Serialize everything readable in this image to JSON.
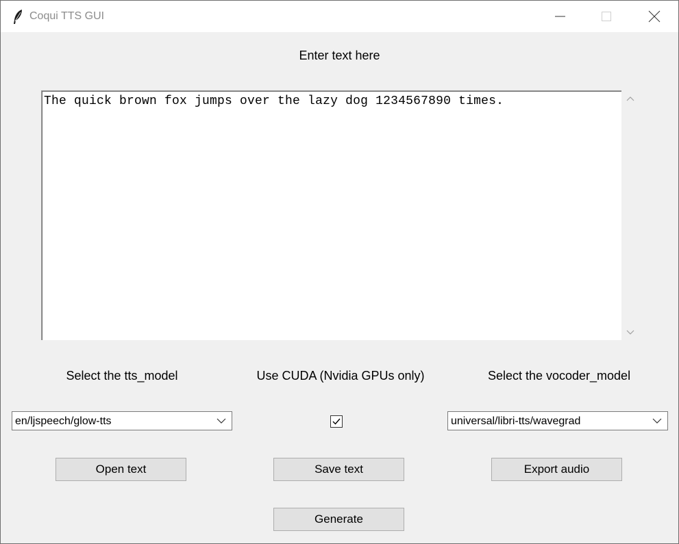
{
  "window": {
    "title": "Coqui TTS GUI",
    "icon": "feather-icon",
    "controls": [
      "minimize-icon",
      "maximize-icon",
      "close-icon"
    ]
  },
  "prompt_label": "Enter text here",
  "text_area": {
    "value": "The quick brown fox jumps over the lazy dog 1234567890 times."
  },
  "tts_model": {
    "label": "Select the tts_model",
    "selected": "en/ljspeech/glow-tts"
  },
  "cuda": {
    "label": "Use CUDA (Nvidia GPUs only)",
    "checked": true
  },
  "vocoder_model": {
    "label": "Select the vocoder_model",
    "selected": "universal/libri-tts/wavegrad"
  },
  "buttons": {
    "open_text": "Open text",
    "save_text": "Save text",
    "export_audio": "Export audio",
    "generate": "Generate"
  },
  "colors": {
    "window_bg": "#f0f0f0",
    "titlebar_bg": "#ffffff",
    "button_bg": "#e1e1e1",
    "button_border": "#adadad"
  }
}
